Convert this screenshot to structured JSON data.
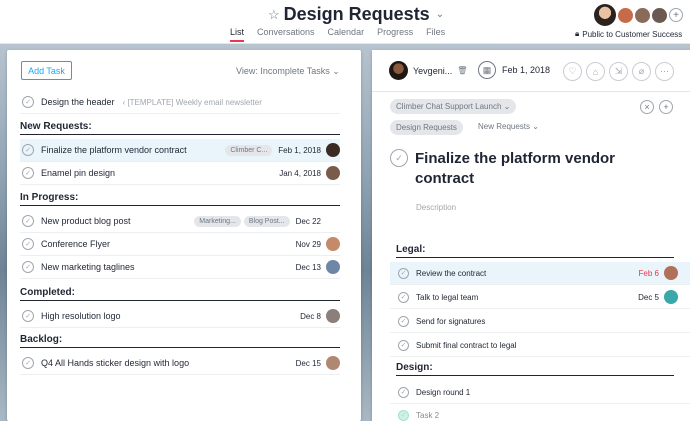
{
  "project": {
    "title": "Design Requests",
    "tabs": [
      "List",
      "Conversations",
      "Calendar",
      "Progress",
      "Files"
    ],
    "active_tab": "List",
    "privacy": "Public to Customer Success"
  },
  "left": {
    "add_task": "Add Task",
    "view_filter": "View: Incomplete Tasks",
    "top_task": {
      "name": "Design the header",
      "meta": "‹ [TEMPLATE] Weekly email newsletter"
    },
    "sections": [
      {
        "name": "New Requests:",
        "tasks": [
          {
            "name": "Finalize the platform vendor contract",
            "tags": [
              "Climber C..."
            ],
            "date": "Feb 1, 2018",
            "selected": true,
            "avatar_color": "#3b2a22"
          },
          {
            "name": "Enamel pin design",
            "tags": [],
            "date": "Jan 4, 2018",
            "avatar_color": "#7a5a4a"
          }
        ]
      },
      {
        "name": "In Progress:",
        "tasks": [
          {
            "name": "New product blog post",
            "tags": [
              "Marketing...",
              "Blog Post..."
            ],
            "date": "Dec 22",
            "avatar_color": ""
          },
          {
            "name": "Conference Flyer",
            "tags": [],
            "date": "Nov 29",
            "avatar_color": "#c48a6a"
          },
          {
            "name": "New marketing taglines",
            "tags": [],
            "date": "Dec 13",
            "avatar_color": "#6f87a6"
          }
        ]
      },
      {
        "name": "Completed:",
        "tasks": [
          {
            "name": "High resolution logo",
            "tags": [],
            "date": "Dec 8",
            "avatar_color": "#8a7f7a"
          }
        ]
      },
      {
        "name": "Backlog:",
        "tasks": [
          {
            "name": "Q4 All Hands sticker design with logo",
            "tags": [],
            "date": "Dec 15",
            "avatar_color": "#b08770"
          }
        ]
      }
    ]
  },
  "right": {
    "assignee": "Yevgeni...",
    "due_date": "Feb 1, 2018",
    "parent_pill": "Climber Chat Support Launch",
    "project_pill": "Design Requests",
    "section_pill": "New Requests",
    "task_title": "Finalize the platform vendor contract",
    "description_placeholder": "Description",
    "subsections": [
      {
        "name": "Legal:",
        "tasks": [
          {
            "name": "Review the contract",
            "date": "Feb 6",
            "overdue": true,
            "selected": true,
            "avatar_color": "#b0705a"
          },
          {
            "name": "Talk to legal team",
            "date": "Dec 5",
            "avatar_color": "#3aa8a8"
          },
          {
            "name": "Send for signatures",
            "date": ""
          },
          {
            "name": "Submit final contract to legal",
            "date": ""
          }
        ]
      },
      {
        "name": "Design:",
        "tasks": [
          {
            "name": "Design round 1",
            "date": ""
          },
          {
            "name": "Task 2",
            "date": "",
            "completed": true
          }
        ]
      }
    ]
  },
  "colors": {
    "accent": "#14aaf5",
    "tab_underline": "#e8384f",
    "overdue": "#e8384f"
  },
  "icons": [
    "star-icon",
    "chevron-down-icon",
    "plus-icon",
    "lock-icon",
    "trash-icon",
    "calendar-icon",
    "heart-icon",
    "tag-icon",
    "subtask-icon",
    "attachment-icon",
    "more-icon",
    "close-icon",
    "check-icon"
  ]
}
